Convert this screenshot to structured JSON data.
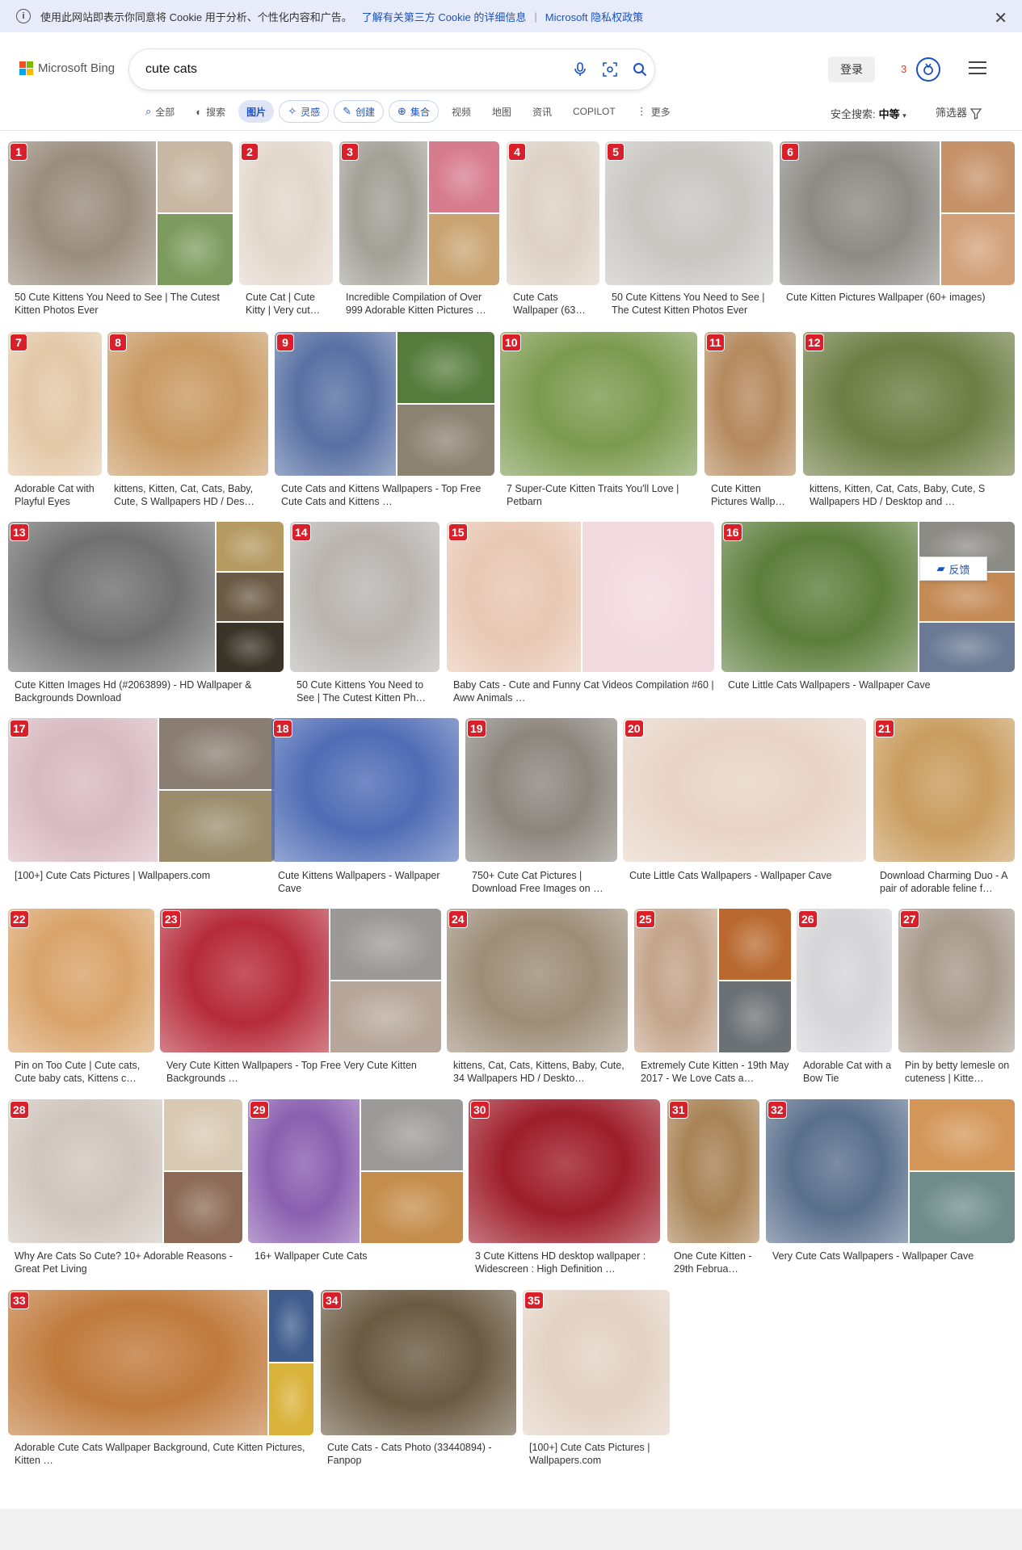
{
  "cookie": {
    "text": "使用此网站即表示你同意将 Cookie 用于分析、个性化内容和广告。",
    "link1": "了解有关第三方 Cookie 的详细信息",
    "link2": "Microsoft 隐私权政策"
  },
  "logo_text": "Microsoft Bing",
  "search": {
    "value": "cute cats"
  },
  "header": {
    "signin": "登录",
    "points": "3"
  },
  "tabs": {
    "all": "全部",
    "search": "搜索",
    "images": "图片",
    "inspire": "灵感",
    "create": "创建",
    "collections": "集合",
    "videos": "视频",
    "maps": "地图",
    "news": "资讯",
    "copilot": "COPILOT",
    "more": "更多"
  },
  "safe_search": {
    "label": "安全搜索:",
    "value": "中等"
  },
  "filter_label": "筛选器",
  "feedback_label": "反馈",
  "colors": {
    "accent": "#1a52c4",
    "badge": "#d9202a"
  },
  "results": [
    {
      "n": "1",
      "caption": "50 Cute Kittens You Need to See | The Cutest Kitten Photos Ever",
      "colors": [
        "#9a8d7e",
        "#c8b7a2",
        "#7d9b5e"
      ]
    },
    {
      "n": "2",
      "caption": "Cute Cat | Cute Kitty | Very cut…",
      "colors": [
        "#e2d7cc"
      ]
    },
    {
      "n": "3",
      "caption": "Incredible Compilation of Over 999 Adorable Kitten Pictures …",
      "colors": [
        "#a3a097",
        "#d77b8e",
        "#c9a472"
      ]
    },
    {
      "n": "4",
      "caption": "Cute Cats Wallpaper (63…",
      "colors": [
        "#ddd2c5"
      ]
    },
    {
      "n": "5",
      "caption": "50 Cute Kittens You Need to See | The Cutest Kitten Photos Ever",
      "colors": [
        "#c9c6c2"
      ]
    },
    {
      "n": "6",
      "caption": "Cute Kitten Pictures Wallpaper (60+ images)",
      "colors": [
        "#8e8b86",
        "#c69269",
        "#d2a17a"
      ]
    },
    {
      "n": "7",
      "caption": "Adorable Cat with Playful Eyes",
      "colors": [
        "#e3c8a7"
      ]
    },
    {
      "n": "8",
      "caption": "kittens, Kitten, Cat, Cats, Baby, Cute, S Wallpapers HD / Des…",
      "colors": [
        "#c99a63"
      ]
    },
    {
      "n": "9",
      "caption": "Cute Cats and Kittens Wallpapers - Top Free Cute Cats and Kittens …",
      "colors": [
        "#5870a3",
        "#567b3c",
        "#8b8271"
      ]
    },
    {
      "n": "10",
      "caption": "7 Super-Cute Kitten Traits You'll Love | Petbarn",
      "colors": [
        "#7c9a4f"
      ]
    },
    {
      "n": "11",
      "caption": "Cute Kitten Pictures Wallp…",
      "colors": [
        "#b58a5e"
      ]
    },
    {
      "n": "12",
      "caption": "kittens, Kitten, Cat, Cats, Baby, Cute, S Wallpapers HD / Desktop and …",
      "colors": [
        "#6d7d43"
      ]
    },
    {
      "n": "13",
      "caption": "Cute Kitten Images Hd (#2063899) - HD Wallpaper & Backgrounds Download",
      "colors": [
        "#707070",
        "#b59a62",
        "#6b5a45",
        "#3a3428"
      ]
    },
    {
      "n": "14",
      "caption": "50 Cute Kittens You Need to See | The Cutest Kitten Ph…",
      "colors": [
        "#b9b4b0"
      ]
    },
    {
      "n": "15",
      "caption": "Baby Cats - Cute and Funny Cat Videos Compilation #60 | Aww Animals …",
      "colors": [
        "#e8c7b3",
        "#f2d9e0"
      ]
    },
    {
      "n": "16",
      "caption": "Cute Little Cats Wallpapers - Wallpaper Cave",
      "colors": [
        "#5d7e3c",
        "#8c8b86",
        "#c48a56",
        "#6a7a94"
      ]
    },
    {
      "n": "17",
      "caption": "[100+] Cute Cats Pictures | Wallpapers.com",
      "colors": [
        "#d8b9c2",
        "#8a7e72",
        "#9b8d6c"
      ]
    },
    {
      "n": "18",
      "caption": "Cute Kittens Wallpapers - Wallpaper Cave",
      "colors": [
        "#4f6cb5"
      ]
    },
    {
      "n": "19",
      "caption": "750+ Cute Cat Pictures | Download Free Images on …",
      "colors": [
        "#8c867e"
      ]
    },
    {
      "n": "20",
      "caption": "Cute Little Cats Wallpapers - Wallpaper Cave",
      "colors": [
        "#e7d4c6"
      ]
    },
    {
      "n": "21",
      "caption": "Download Charming Duo - A pair of adorable feline f…",
      "colors": [
        "#c99c5e"
      ]
    },
    {
      "n": "22",
      "caption": "Pin on Too Cute | Cute cats, Cute baby cats, Kittens c…",
      "colors": [
        "#d9a36a"
      ]
    },
    {
      "n": "23",
      "caption": "Very Cute Kitten Wallpapers - Top Free Very Cute Kitten Backgrounds …",
      "colors": [
        "#b62b3a",
        "#9c9896",
        "#b7a79a"
      ]
    },
    {
      "n": "24",
      "caption": "kittens, Cat, Cats, Kittens, Baby, Cute, 34 Wallpapers HD / Deskto…",
      "colors": [
        "#9d8d78"
      ]
    },
    {
      "n": "25",
      "caption": "Extremely Cute Kitten - 19th May 2017 - We Love Cats a…",
      "colors": [
        "#c4a48a",
        "#b9692f",
        "#6c7175"
      ]
    },
    {
      "n": "26",
      "caption": "Adorable Cat with a Bow Tie",
      "colors": [
        "#d5d5d8"
      ]
    },
    {
      "n": "27",
      "caption": "Pin by betty lemesle on cuteness | Kitte…",
      "colors": [
        "#a89a8c"
      ]
    },
    {
      "n": "28",
      "caption": "Why Are Cats So Cute? 10+ Adorable Reasons - Great Pet Living",
      "colors": [
        "#cfc6bd",
        "#d8c9b3",
        "#8c6a55"
      ]
    },
    {
      "n": "29",
      "caption": "16+ Wallpaper Cute Cats",
      "colors": [
        "#8a5fb0",
        "#9c9a98",
        "#c58d4c"
      ]
    },
    {
      "n": "30",
      "caption": "3 Cute Kittens HD desktop wallpaper : Widescreen : High Definition …",
      "colors": [
        "#9e1d2a"
      ]
    },
    {
      "n": "31",
      "caption": "One Cute Kitten - 29th Februa…",
      "colors": [
        "#a88356"
      ]
    },
    {
      "n": "32",
      "caption": "Very Cute Cats Wallpapers - Wallpaper Cave",
      "colors": [
        "#5a6f8c",
        "#d39658",
        "#6f8c8a"
      ]
    },
    {
      "n": "33",
      "caption": "Adorable Cute Cats Wallpaper Background, Cute Kitten Pictures, Kitten …",
      "colors": [
        "#c07a3c",
        "#3f5c8c",
        "#d9b23a"
      ]
    },
    {
      "n": "34",
      "caption": "Cute Cats - Cats Photo (33440894) - Fanpop",
      "colors": [
        "#6a5a42"
      ]
    },
    {
      "n": "35",
      "caption": "[100+] Cute Cats Pictures | Wallpapers.com",
      "colors": [
        "#e3d2c4"
      ]
    }
  ]
}
